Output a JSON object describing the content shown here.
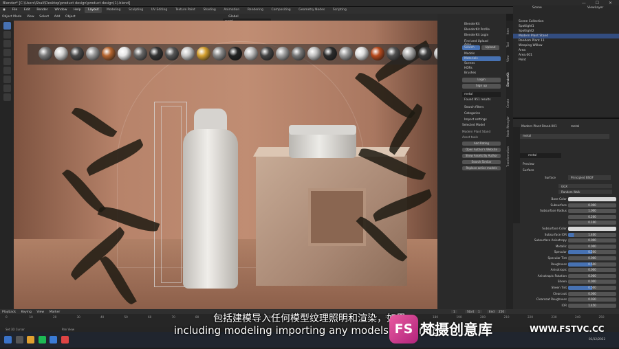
{
  "window": {
    "title": "Blender* [C:\\Users\\Shali\\Desktop\\product design\\product design(1).blend]",
    "controls": "— ☐ ✕"
  },
  "menu": [
    "File",
    "Edit",
    "Render",
    "Window",
    "Help"
  ],
  "workspaces": [
    "Layout",
    "Modeling",
    "Sculpting",
    "UV Editing",
    "Texture Paint",
    "Shading",
    "Animation",
    "Rendering",
    "Compositing",
    "Geometry Nodes",
    "Scripting"
  ],
  "active_workspace": "Layout",
  "scene_label": "Scene",
  "viewlayer_label": "ViewLayer",
  "viewport_header": {
    "mode": "Object Mode",
    "items": [
      "View",
      "Select",
      "Add",
      "Object"
    ],
    "transform": "Global",
    "search_value": "metal"
  },
  "npanel": {
    "header": "BlenderKit",
    "profile": "BlenderKit Profile",
    "login": "BlenderKit Login",
    "first_upload": "Find and Upload Asse...",
    "tabs": [
      "Search",
      "Upload"
    ],
    "categories": [
      "Models",
      "Materials",
      "Scenes",
      "HDRs",
      "Brushes"
    ],
    "login_btn": "Login",
    "signup_btn": "Sign up",
    "search": "metal",
    "found": "Found 951 results",
    "sections": [
      "Search filters",
      "Categories",
      "Import settings"
    ],
    "selected_model": "Selected Model",
    "model_name": "Modern Plant Stand",
    "asset_tools": "Asset tools",
    "buttons": [
      "Add Rating",
      "Open Author's Website",
      "Show Assets By Author",
      "Search Similar",
      "Replace active models"
    ]
  },
  "vtabs": [
    "Item",
    "Tool",
    "View",
    "BlenderKit",
    "Create",
    "Node Wrangler",
    "Transformation"
  ],
  "outliner": {
    "items": [
      "Scene Collection",
      "Spotlight1",
      "Spotlight2",
      "Modern Plant Stand",
      "Random Plant 11",
      "Weeping Willow",
      "Area",
      "Area.001",
      "Point"
    ],
    "selected_index": 3
  },
  "properties": {
    "object": "Modern Plant Stand.001",
    "material": "metal",
    "slot": "metal",
    "data_name": "metal",
    "sections": [
      "Preview",
      "Surface"
    ],
    "surface_shader": "Principled BSDF",
    "method": "GGX",
    "subsurface_method": "Random Walk",
    "rows": [
      {
        "label": "Base Color",
        "value": "",
        "kind": "white"
      },
      {
        "label": "Subsurface",
        "value": "0.000",
        "kind": "plain"
      },
      {
        "label": "Subsurface Radius",
        "value": "1.000",
        "kind": "plain"
      },
      {
        "label": "",
        "value": "0.200",
        "kind": "plain"
      },
      {
        "label": "",
        "value": "0.100",
        "kind": "plain"
      },
      {
        "label": "Subsurface Color",
        "value": "",
        "kind": "white"
      },
      {
        "label": "Subsurface IOR",
        "value": "1.400",
        "kind": "blue",
        "fill": "12%"
      },
      {
        "label": "Subsurface Anisotropy",
        "value": "0.000",
        "kind": "plain"
      },
      {
        "label": "Metallic",
        "value": "0.000",
        "kind": "plain"
      },
      {
        "label": "Specular",
        "value": "0.500",
        "kind": "blue",
        "fill": "50%"
      },
      {
        "label": "Specular Tint",
        "value": "0.000",
        "kind": "plain"
      },
      {
        "label": "Roughness",
        "value": "0.500",
        "kind": "blue",
        "fill": "50%"
      },
      {
        "label": "Anisotropic",
        "value": "0.000",
        "kind": "plain"
      },
      {
        "label": "Anisotropic Rotation",
        "value": "0.000",
        "kind": "plain"
      },
      {
        "label": "Sheen",
        "value": "0.000",
        "kind": "plain"
      },
      {
        "label": "Sheen Tint",
        "value": "0.500",
        "kind": "blue",
        "fill": "50%"
      },
      {
        "label": "Clearcoat",
        "value": "0.000",
        "kind": "plain"
      },
      {
        "label": "Clearcoat Roughness",
        "value": "0.030",
        "kind": "plain"
      },
      {
        "label": "IOR",
        "value": "1.450",
        "kind": "plain"
      },
      {
        "label": "Transmission",
        "value": "0.000",
        "kind": "plain"
      },
      {
        "label": "Transmission Roughness",
        "value": "0.000",
        "kind": "plain"
      }
    ]
  },
  "timeline": {
    "menu": [
      "Playback",
      "Keying",
      "View",
      "Marker"
    ],
    "current": "1",
    "start": "Start",
    "start_val": "1",
    "end": "End",
    "end_val": "250",
    "ticks": [
      "0",
      "10",
      "20",
      "30",
      "40",
      "50",
      "60",
      "70",
      "80",
      "90",
      "100",
      "110",
      "120",
      "130",
      "140",
      "150",
      "160",
      "170",
      "180",
      "190",
      "200",
      "210",
      "220",
      "230",
      "240",
      "250"
    ]
  },
  "status": {
    "left": "Set 3D Cursor",
    "mid": "Pan View"
  },
  "taskbar": {
    "date": "01/12/2022"
  },
  "subtitles": {
    "cn": "包括建模导入任何模型纹理照明和渲染，如果",
    "en": "including modeling importing any models texturing l"
  },
  "watermark": {
    "logo": "FS",
    "brand": "梵摄创意库",
    "url": "WWW.FSTVC.CC"
  },
  "colors": {
    "accent": "#4772b3",
    "selected": "#334d80",
    "brand": "#d6338a"
  }
}
